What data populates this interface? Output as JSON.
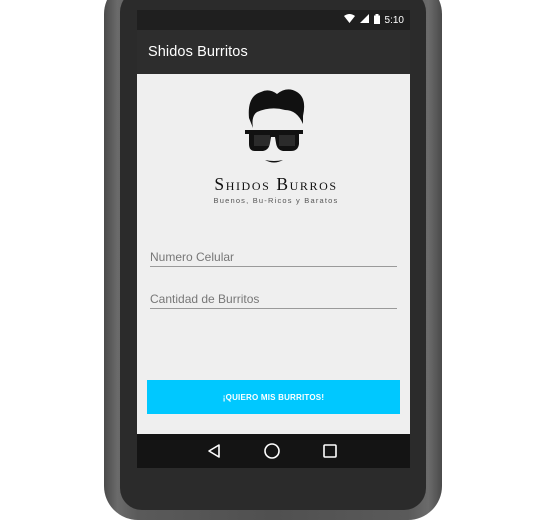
{
  "status_bar": {
    "time": "5:10",
    "icons": [
      "wifi-icon",
      "signal-icon",
      "battery-icon"
    ]
  },
  "app_bar": {
    "title": "Shidos Burritos"
  },
  "brand": {
    "name": "Shidos Burros",
    "tagline": "Buenos, Bu-Ricos y Baratos"
  },
  "form": {
    "phone_placeholder": "Numero Celular",
    "quantity_placeholder": "Cantidad de Burritos",
    "submit_label": "¡QUIERO MIS BURRITOS!"
  },
  "nav": {
    "icons": [
      "back-icon",
      "home-icon",
      "recents-icon"
    ]
  },
  "colors": {
    "accent": "#00c8ff",
    "app_bar": "#2d2d2d",
    "status_bar": "#1f1f1f",
    "screen_bg": "#efefef"
  }
}
